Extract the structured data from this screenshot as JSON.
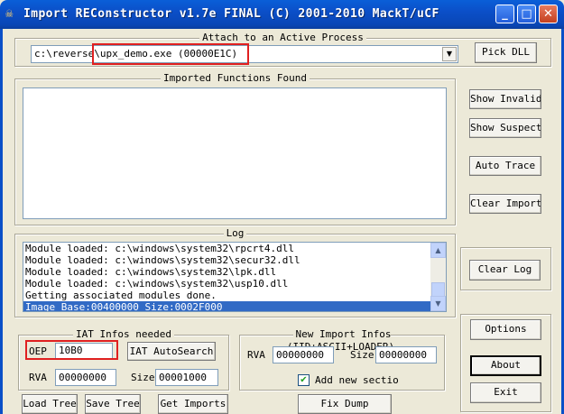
{
  "window": {
    "title": "Import REConstructor v1.7e FINAL (C) 2001-2010 MackT/uCF",
    "minimize": "_",
    "maximize": "□",
    "close": "✕"
  },
  "attach": {
    "legend": "Attach to an Active Process",
    "process_prefix": "c:\\reverse\\",
    "process_name": "upx_demo.exe (00000E1C)",
    "pick_dll": "Pick DLL"
  },
  "imports": {
    "legend": "Imported Functions Found",
    "show_invalid": "Show Invalid",
    "show_suspect": "Show Suspect",
    "auto_trace": "Auto Trace",
    "clear_imports": "Clear Imports"
  },
  "log": {
    "legend": "Log",
    "lines": [
      "Module loaded: c:\\windows\\system32\\rpcrt4.dll",
      "Module loaded: c:\\windows\\system32\\secur32.dll",
      "Module loaded: c:\\windows\\system32\\lpk.dll",
      "Module loaded: c:\\windows\\system32\\usp10.dll",
      "Getting associated modules done.",
      "Image Base:00400000 Size:0002F000"
    ],
    "clear_log": "Clear Log"
  },
  "iat": {
    "legend": "IAT Infos needed",
    "oep_label": "OEP",
    "oep_value": "10B0",
    "autosearch": "IAT AutoSearch",
    "rva_label": "RVA",
    "rva_value": "00000000",
    "size_label": "Size",
    "size_value": "00001000"
  },
  "new_import": {
    "legend": "New Import Infos (IID+ASCII+LOADER)",
    "rva_label": "RVA",
    "rva_value": "00000000",
    "size_label": "Size",
    "size_value": "00000000",
    "add_section_label": "Add new sectio",
    "add_section_checked": true,
    "check_mark": "✔"
  },
  "actions": {
    "options": "Options",
    "about": "About",
    "exit": "Exit",
    "load_tree": "Load Tree",
    "save_tree": "Save Tree",
    "get_imports": "Get Imports",
    "fix_dump": "Fix Dump"
  },
  "icons": {
    "app": "skull-icon",
    "combo_arrow": "▼",
    "scroll_up": "▲",
    "scroll_down": "▼"
  },
  "colors": {
    "titlebar": "#0a4fc8",
    "highlight": "#e02020",
    "selection": "#316ac5"
  }
}
